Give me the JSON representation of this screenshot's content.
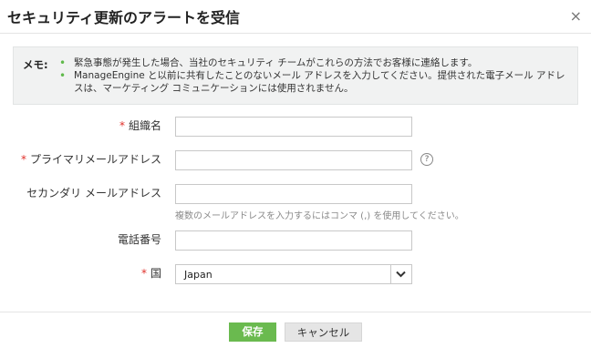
{
  "dialog": {
    "title": "セキュリティ更新のアラートを受信",
    "close_glyph": "×"
  },
  "memo": {
    "label": "メモ:",
    "bullet": "•",
    "items": [
      "緊急事態が発生した場合、当社のセキュリティ チームがこれらの方法でお客様に連絡します。",
      "ManageEngine と以前に共有したことのないメール アドレスを入力してください。提供された電子メール アドレスは、マーケティング コミュニケーションには使用されません。"
    ]
  },
  "form": {
    "required_mark": "*",
    "organization": {
      "label": "組織名",
      "value": ""
    },
    "primary_email": {
      "label": "プライマリメールアドレス",
      "value": "",
      "help_glyph": "?"
    },
    "secondary_email": {
      "label": "セカンダリ メールアドレス",
      "value": "",
      "hint": "複数のメールアドレスを入力するにはコンマ (,) を使用してください。"
    },
    "phone": {
      "label": "電話番号",
      "value": ""
    },
    "country": {
      "label": "国",
      "selected": "Japan"
    }
  },
  "footer": {
    "save_label": "保存",
    "cancel_label": "キャンセル"
  },
  "colors": {
    "accent": "#6aba4f",
    "required": "#e0302a",
    "memo_bg": "#f1f2f2"
  }
}
